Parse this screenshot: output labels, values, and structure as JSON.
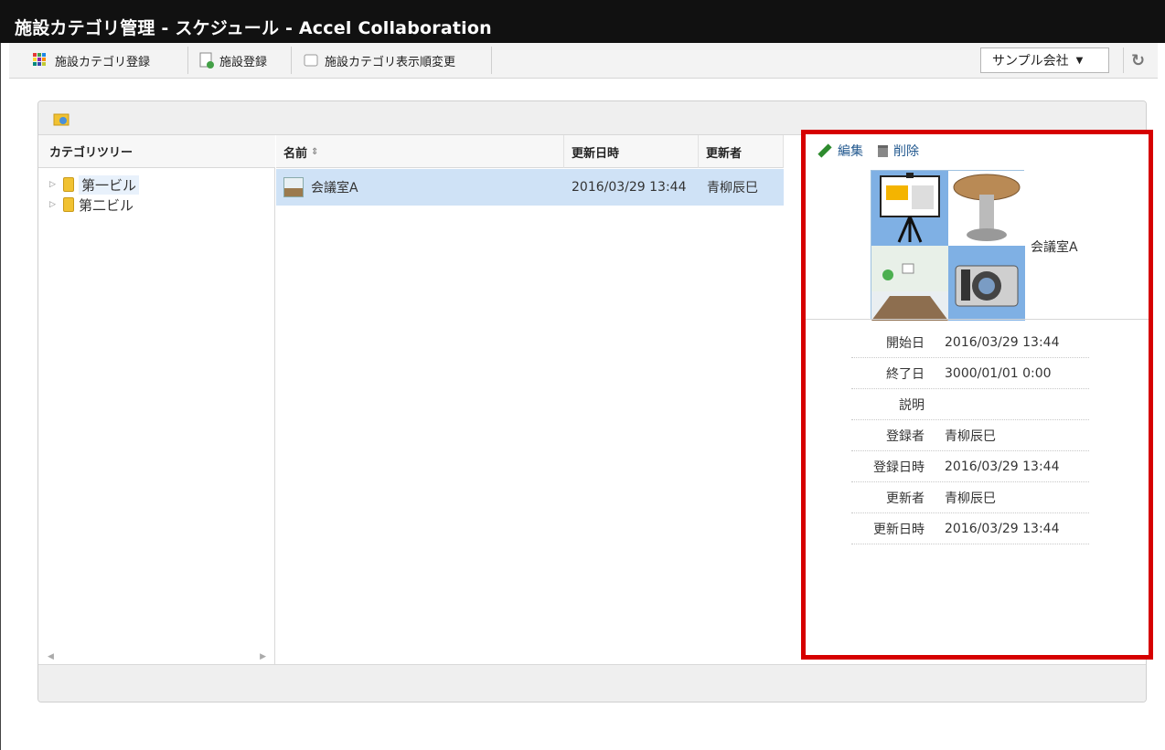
{
  "window": {
    "title": "施設カテゴリ管理 - スケジュール - Accel Collaboration"
  },
  "toolbar": {
    "buttons": [
      {
        "label": "施設カテゴリ登録",
        "icon": "grid-icon"
      },
      {
        "label": "施設登録",
        "icon": "add-document-icon"
      },
      {
        "label": "施設カテゴリ表示順変更",
        "icon": "sort-icon"
      }
    ],
    "company_select": "サンプル会社",
    "refresh_icon": "refresh-icon"
  },
  "tree": {
    "header": "カテゴリツリー",
    "items": [
      {
        "label": "第一ビル"
      },
      {
        "label": "第二ビル"
      }
    ]
  },
  "list": {
    "headers": {
      "name": "名前",
      "updated_at": "更新日時",
      "updated_by": "更新者"
    },
    "rows": [
      {
        "name": "会議室A",
        "updated_at": "2016/03/29 13:44",
        "updated_by": "青柳辰巳"
      }
    ]
  },
  "detail": {
    "edit_label": "編集",
    "delete_label": "削除",
    "name": "会議室A",
    "properties": [
      {
        "key": "開始日",
        "value": "2016/03/29 13:44"
      },
      {
        "key": "終了日",
        "value": "3000/01/01 0:00"
      },
      {
        "key": "説明",
        "value": ""
      },
      {
        "key": "登録者",
        "value": "青柳辰巳"
      },
      {
        "key": "登録日時",
        "value": "2016/03/29 13:44"
      },
      {
        "key": "更新者",
        "value": "青柳辰巳"
      },
      {
        "key": "更新日時",
        "value": "2016/03/29 13:44"
      }
    ]
  },
  "colors": {
    "highlight_border": "#d60000",
    "selected_row": "#cfe2f6",
    "title_bar": "#111111"
  }
}
